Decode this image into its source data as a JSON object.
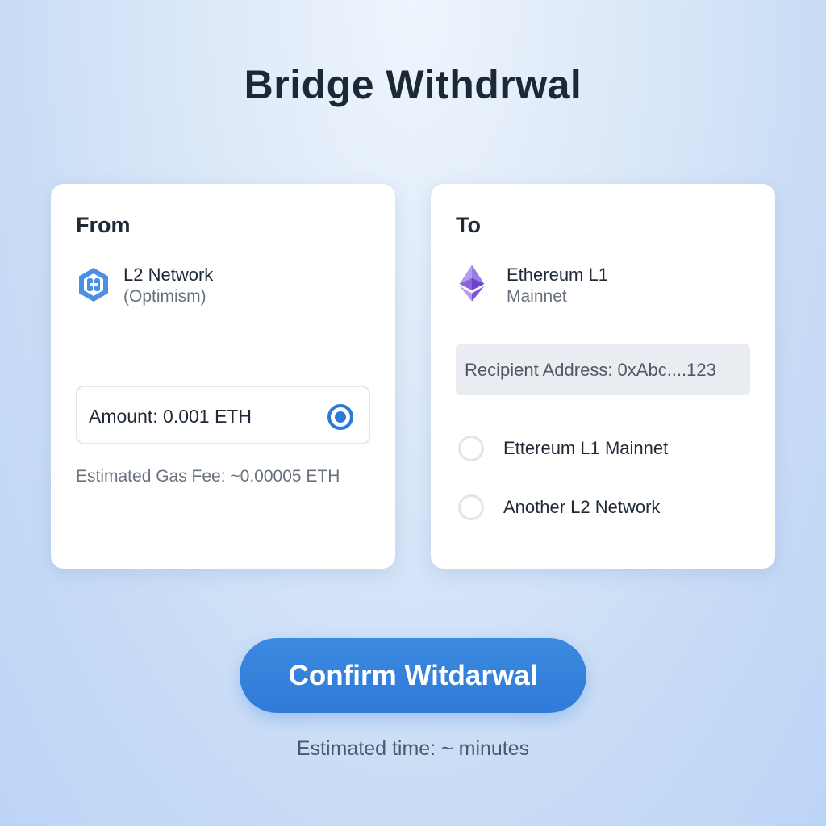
{
  "page": {
    "title": "Bridge Withdrwal"
  },
  "from_card": {
    "heading": "From",
    "network_name": "L2 Network",
    "network_sub": "(Optimism)",
    "network_icon": "hexagon-link-icon",
    "amount_label": "Amount: 0.001 ETH",
    "amount_selected": true,
    "gas_fee": "Estimated Gas Fee: ~0.00005 ETH"
  },
  "to_card": {
    "heading": "To",
    "network_name": "Ethereum L1",
    "network_sub": "Mainnet",
    "network_icon": "ethereum-icon",
    "recipient": "Recipient Address: 0xAbc....123",
    "options": [
      {
        "label": "Ettereum L1 Mainnet",
        "selected": false
      },
      {
        "label": "Another L2 Network",
        "selected": false
      }
    ]
  },
  "actions": {
    "confirm_label": "Confirm Witdarwal",
    "estimated_time": "Estimated time: ~ minutes"
  },
  "colors": {
    "accent": "#2f7bd7",
    "eth_purple": "#7b52d6",
    "l2_blue": "#4a90e2"
  }
}
